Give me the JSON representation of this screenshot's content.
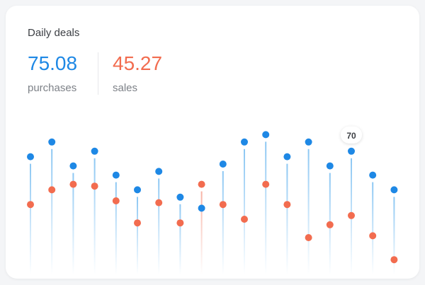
{
  "card": {
    "title": "Daily deals"
  },
  "stats": [
    {
      "value": "75.08",
      "label": "purchases",
      "color": "#1e88e5"
    },
    {
      "value": "45.27",
      "label": "sales",
      "color": "#f26c4f"
    }
  ],
  "tooltip": {
    "text": "70",
    "index": 15
  },
  "colors": {
    "purchases": "#1e88e5",
    "sales": "#f26c4f",
    "purchases_line": "#8cc7f3",
    "sales_line": "#f7b2a4"
  },
  "chart_data": {
    "type": "scatter",
    "x": [
      1,
      2,
      3,
      4,
      5,
      6,
      7,
      8,
      9,
      10,
      11,
      12,
      13,
      14,
      15,
      16,
      17,
      18
    ],
    "ylim": [
      0,
      100
    ],
    "series": [
      {
        "name": "purchases",
        "values": [
          64,
          72,
          59,
          67,
          54,
          46,
          56,
          42,
          36,
          60,
          72,
          76,
          64,
          72,
          59,
          67,
          54,
          46
        ]
      },
      {
        "name": "sales",
        "values": [
          38,
          46,
          49,
          48,
          40,
          28,
          39,
          28,
          49,
          38,
          30,
          49,
          38,
          20,
          27,
          32,
          21,
          8
        ]
      }
    ],
    "highlighted_index": 8
  }
}
